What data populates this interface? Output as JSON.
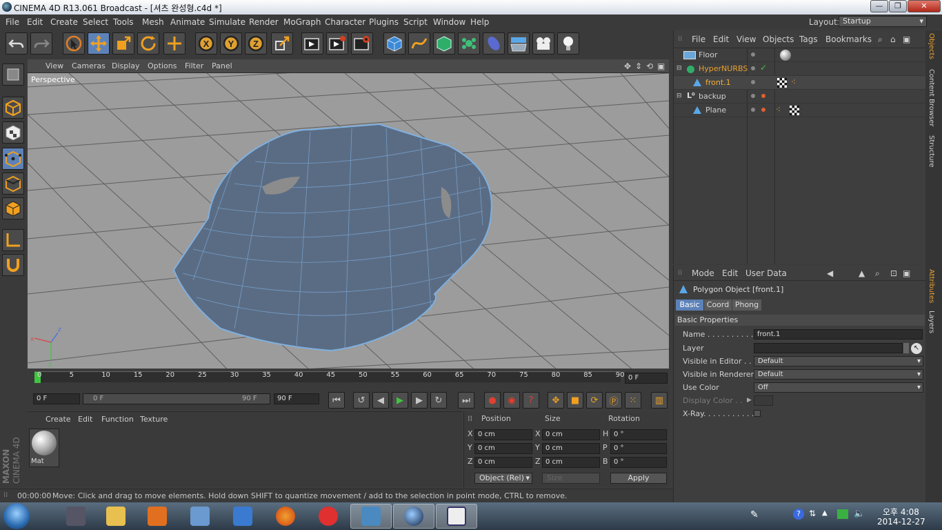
{
  "window": {
    "title": "CINEMA 4D R13.061 Broadcast - [셔츠 완성형.c4d *]",
    "buttons": [
      "—",
      "❐",
      "✕"
    ]
  },
  "menubar": [
    "File",
    "Edit",
    "Create",
    "Select",
    "Tools",
    "Mesh",
    "Animate",
    "Simulate",
    "Render",
    "MoGraph",
    "Character",
    "Plugins",
    "Script",
    "Window",
    "Help"
  ],
  "layout": {
    "label": "Layout:",
    "value": "Startup"
  },
  "toolbar": [
    {
      "name": "undo-icon"
    },
    {
      "name": "redo-icon"
    },
    {
      "name": "live-selection-icon"
    },
    {
      "name": "move-icon",
      "active": true
    },
    {
      "name": "scale-icon"
    },
    {
      "name": "rotate-icon"
    },
    {
      "name": "recent-tool-icon"
    },
    {
      "name": "x-axis-icon"
    },
    {
      "name": "y-axis-icon"
    },
    {
      "name": "z-axis-icon"
    },
    {
      "name": "coordinate-system-icon"
    },
    {
      "name": "render-view-icon"
    },
    {
      "name": "render-picture-viewer-icon"
    },
    {
      "name": "render-settings-icon"
    },
    {
      "name": "cube-icon"
    },
    {
      "name": "spline-icon"
    },
    {
      "name": "nurbs-icon"
    },
    {
      "name": "array-icon"
    },
    {
      "name": "deformer-icon"
    },
    {
      "name": "floor-icon"
    },
    {
      "name": "camera-icon"
    },
    {
      "name": "light-icon"
    }
  ],
  "left_tools": [
    {
      "name": "make-editable-icon"
    },
    {
      "name": "model-mode-icon"
    },
    {
      "name": "texture-mode-icon"
    },
    {
      "name": "points-mode-icon",
      "active": true
    },
    {
      "name": "edges-mode-icon"
    },
    {
      "name": "polygons-mode-icon"
    },
    {
      "name": "axis-mode-icon"
    },
    {
      "name": "snap-icon"
    }
  ],
  "viewport": {
    "menu": [
      "View",
      "Cameras",
      "Display",
      "Options",
      "Filter",
      "Panel"
    ],
    "label": "Perspective",
    "axes": {
      "x": "x",
      "y": "y",
      "z": "z"
    }
  },
  "timeline": {
    "ticks": [
      "0",
      "5",
      "10",
      "15",
      "20",
      "25",
      "30",
      "35",
      "40",
      "45",
      "50",
      "55",
      "60",
      "65",
      "70",
      "75",
      "80",
      "85",
      "90"
    ],
    "current_frame": "0 F",
    "start_field": "0 F",
    "range_start": "0 F",
    "range_end": "90 F",
    "end_field": "90 F"
  },
  "materials": {
    "menu": [
      "Create",
      "Edit",
      "Function",
      "Texture"
    ],
    "items": [
      {
        "label": "Mat"
      }
    ],
    "logo_line1": "MAXON",
    "logo_line2": "CINEMA 4D"
  },
  "coordinates": {
    "headers": [
      "Position",
      "Size",
      "Rotation"
    ],
    "rows": [
      {
        "a": "X",
        "pos": "0 cm",
        "b": "X",
        "size": "0 cm",
        "c": "H",
        "rot": "0 °"
      },
      {
        "a": "Y",
        "pos": "0 cm",
        "b": "Y",
        "size": "0 cm",
        "c": "P",
        "rot": "0 °"
      },
      {
        "a": "Z",
        "pos": "0 cm",
        "b": "Z",
        "size": "0 cm",
        "c": "B",
        "rot": "0 °"
      }
    ],
    "mode": "Object (Rel)",
    "size_mode": "Size",
    "apply": "Apply"
  },
  "statusbar": {
    "time": "00:00:00",
    "message": "Move: Click and drag to move elements. Hold down SHIFT to quantize movement / add to the selection in point mode, CTRL to remove."
  },
  "object_manager": {
    "menu": [
      "File",
      "Edit",
      "View",
      "Objects",
      "Tags",
      "Bookmarks"
    ],
    "objects": [
      {
        "name": "Floor",
        "color": "#cfcfcf"
      },
      {
        "name": "HyperNURBS",
        "color": "#e8a030"
      },
      {
        "name": "front.1",
        "color": "#f0b040"
      },
      {
        "name": "backup",
        "color": "#cfcfcf"
      },
      {
        "name": "Plane",
        "color": "#cfcfcf"
      }
    ]
  },
  "attribute_manager": {
    "menu": [
      "Mode",
      "Edit",
      "User Data"
    ],
    "object_title": "Polygon Object [front.1]",
    "tabs": [
      "Basic",
      "Coord",
      "Phong"
    ],
    "section": "Basic Properties",
    "props": [
      {
        "label": "Name . . . . . . . . . . .",
        "value": "front.1"
      },
      {
        "label": "Layer",
        "value": ""
      },
      {
        "label": "Visible in Editor . .",
        "value": "Default"
      },
      {
        "label": "Visible in Renderer",
        "value": "Default"
      },
      {
        "label": "Use Color",
        "value": "Off"
      },
      {
        "label": "Display Color . .",
        "value": ""
      },
      {
        "label": "X-Ray. . . . . . . . . . .",
        "value": ""
      }
    ]
  },
  "side_tabs": {
    "objects": "Objects",
    "content": "Content Browser",
    "structure": "Structure",
    "attributes": "Attributes",
    "layers": "Layers"
  },
  "taskbar": {
    "time": "오후 4:08",
    "date": "2014-12-27"
  },
  "colors": {
    "accent": "#5d82b8",
    "mesh": "#5a6c84",
    "mesh_edge": "#7fb0e0",
    "highlight_orange": "#e8a030"
  }
}
